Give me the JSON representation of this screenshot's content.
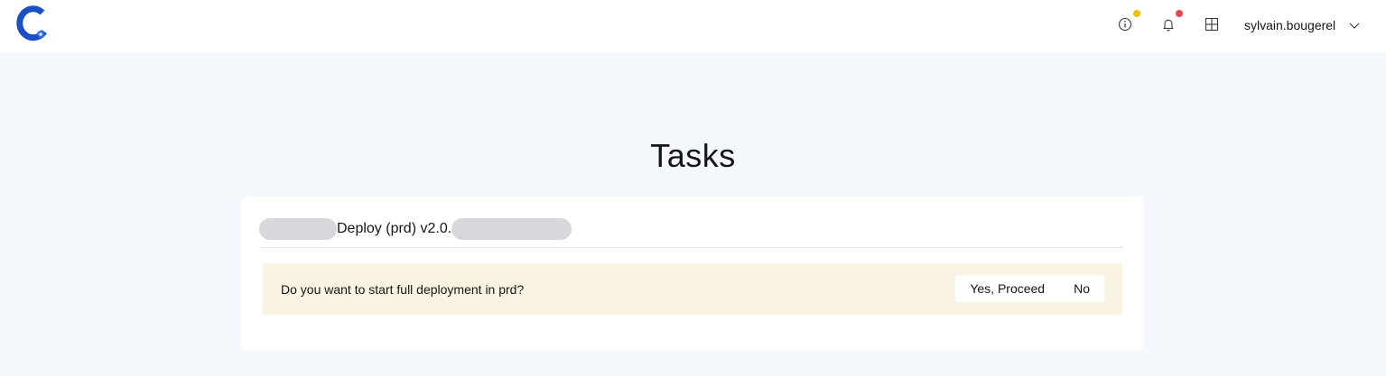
{
  "app": {
    "logo_icon": "c-ring-logo",
    "brand_color": "#1b4fc4"
  },
  "topbar": {
    "info_icon": "info-circle-icon",
    "info_badge_color": "#f2c200",
    "notifications_icon": "bell-icon",
    "notifications_badge_color": "#e5454f",
    "apps_icon": "grid-icon",
    "user_name": "sylvain.bougerel",
    "user_menu_icon": "chevron-down-icon"
  },
  "page": {
    "title": "Tasks"
  },
  "task": {
    "name": "Deploy (prd) v2.0.",
    "prompt": "Do you want to start full deployment in prd?",
    "confirm_label": "Yes, Proceed",
    "cancel_label": "No",
    "prompt_bg": "#f9f3e1"
  }
}
